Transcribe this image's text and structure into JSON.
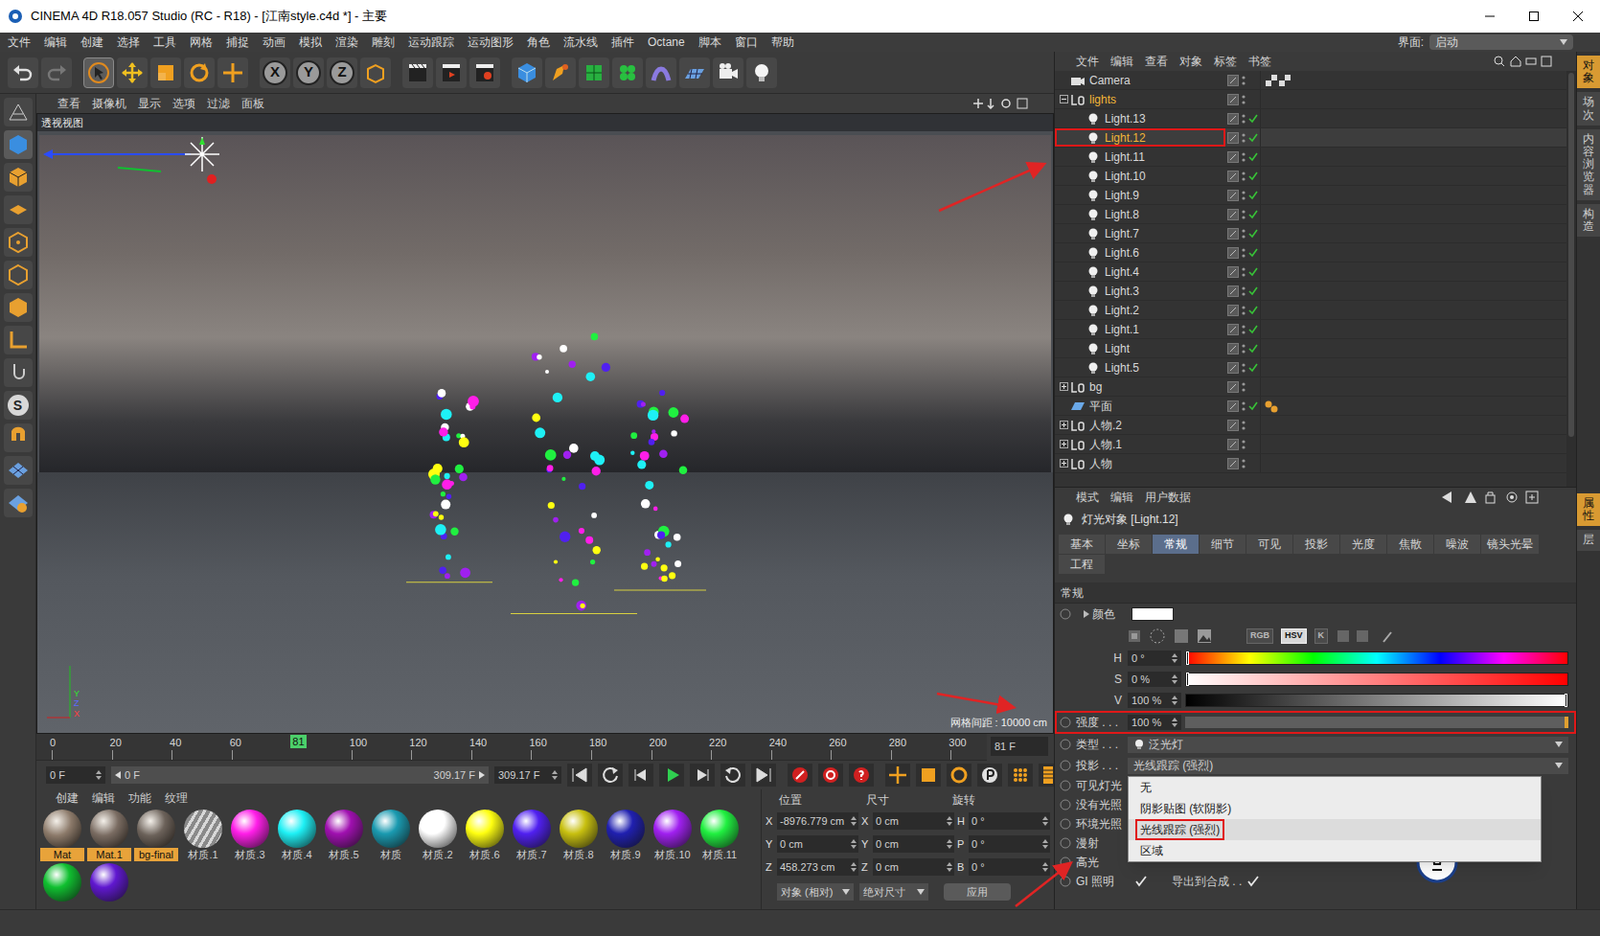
{
  "window": {
    "title": "CINEMA 4D R18.057 Studio (RC - R18) - [江南style.c4d *] - 主要"
  },
  "menu": [
    "文件",
    "编辑",
    "创建",
    "选择",
    "工具",
    "网格",
    "捕捉",
    "动画",
    "模拟",
    "渲染",
    "雕刻",
    "运动跟踪",
    "运动图形",
    "角色",
    "流水线",
    "插件",
    "Octane",
    "脚本",
    "窗口",
    "帮助"
  ],
  "layout_switch": {
    "label": "界面:",
    "value": "启动"
  },
  "toolbar": {
    "axes": [
      "X",
      "Y",
      "Z"
    ]
  },
  "left_tools": {
    "snap_label": "S"
  },
  "viewport": {
    "menu": [
      "查看",
      "摄像机",
      "显示",
      "选项",
      "过滤",
      "面板"
    ],
    "label": "透视视图",
    "grid": "网格间距 : 10000 cm",
    "axes": [
      "Y",
      "Z",
      "X"
    ]
  },
  "timeline": {
    "ticks": [
      "0",
      "20",
      "40",
      "60",
      "100",
      "120",
      "140",
      "160",
      "180",
      "200",
      "220",
      "240",
      "260",
      "280",
      "300"
    ],
    "length": 309.17,
    "current": "81",
    "level": 0.262,
    "frame_field": "81 F",
    "start_field": "0 F",
    "range_start": "0 F",
    "range_end": "309.17 F",
    "end_field": "309.17 F"
  },
  "materials": {
    "menu": [
      "创建",
      "编辑",
      "功能",
      "纹理"
    ],
    "items": [
      {
        "name": "Mat",
        "kind": "texture",
        "color": "#8c7a6a",
        "selected": true
      },
      {
        "name": "Mat.1",
        "kind": "texture",
        "color": "#7a6c62",
        "selected": true
      },
      {
        "name": "bg-final",
        "kind": "texture",
        "color": "#6c625a",
        "selected": true
      },
      {
        "name": "材质.1",
        "kind": "stripes",
        "color": "#8a8a8a",
        "selected": false
      },
      {
        "name": "材质.3",
        "kind": "color",
        "color": "#ff1ee8",
        "selected": false
      },
      {
        "name": "材质.4",
        "kind": "color",
        "color": "#1ef0f5",
        "selected": false
      },
      {
        "name": "材质.5",
        "kind": "color",
        "color": "#a010b0",
        "selected": false
      },
      {
        "name": "材质",
        "kind": "color",
        "color": "#1a9ab0",
        "selected": false
      },
      {
        "name": "材质.2",
        "kind": "color",
        "color": "#ffffff",
        "selected": false
      },
      {
        "name": "材质.6",
        "kind": "color",
        "color": "#ffff10",
        "selected": false
      },
      {
        "name": "材质.7",
        "kind": "color",
        "color": "#5020f0",
        "selected": false
      },
      {
        "name": "材质.8",
        "kind": "color",
        "color": "#c8c010",
        "selected": false
      },
      {
        "name": "材质.9",
        "kind": "color",
        "color": "#2020b0",
        "selected": false
      },
      {
        "name": "材质.10",
        "kind": "color",
        "color": "#a020f0",
        "selected": false
      },
      {
        "name": "材质.11",
        "kind": "color",
        "color": "#20f040",
        "selected": false
      },
      {
        "kind": "color",
        "color": "#10c030",
        "selected": false
      },
      {
        "kind": "color",
        "color": "#6018d0",
        "selected": false
      }
    ]
  },
  "coords": {
    "headers": [
      "位置",
      "尺寸",
      "旋转"
    ],
    "rows": [
      {
        "pos_axis": "X",
        "pos": "-8976.779 cm",
        "size_axis": "X",
        "size": "0 cm",
        "rot_axis": "H",
        "rot": "0 °"
      },
      {
        "pos_axis": "Y",
        "pos": "0 cm",
        "size_axis": "Y",
        "size": "0 cm",
        "rot_axis": "P",
        "rot": "0 °"
      },
      {
        "pos_axis": "Z",
        "pos": "458.273 cm",
        "size_axis": "Z",
        "size": "0 cm",
        "rot_axis": "B",
        "rot": "0 °"
      }
    ],
    "mode": "对象 (相对)",
    "size_mode": "绝对尺寸",
    "apply": "应用"
  },
  "objects": {
    "menu": [
      "文件",
      "编辑",
      "查看",
      "对象",
      "标签",
      "书签"
    ],
    "items": [
      {
        "name": "Camera",
        "kind": "camera",
        "depth": 0,
        "expandable": false,
        "expanded": false,
        "selected": false,
        "annotated": false,
        "enabled": false,
        "tag": "target"
      },
      {
        "name": "lights",
        "kind": "null",
        "depth": 0,
        "expandable": true,
        "expanded": true,
        "selected": true,
        "annotated": false,
        "enabled": false,
        "tag": "none"
      },
      {
        "name": "Light.13",
        "kind": "light",
        "depth": 1,
        "expandable": false,
        "expanded": false,
        "selected": false,
        "annotated": false,
        "enabled": true,
        "tag": "none"
      },
      {
        "name": "Light.12",
        "kind": "light",
        "depth": 1,
        "expandable": false,
        "expanded": false,
        "selected": true,
        "annotated": true,
        "enabled": true,
        "tag": "none"
      },
      {
        "name": "Light.11",
        "kind": "light",
        "depth": 1,
        "expandable": false,
        "expanded": false,
        "selected": false,
        "annotated": false,
        "enabled": true,
        "tag": "none"
      },
      {
        "name": "Light.10",
        "kind": "light",
        "depth": 1,
        "expandable": false,
        "expanded": false,
        "selected": false,
        "annotated": false,
        "enabled": true,
        "tag": "none"
      },
      {
        "name": "Light.9",
        "kind": "light",
        "depth": 1,
        "expandable": false,
        "expanded": false,
        "selected": false,
        "annotated": false,
        "enabled": true,
        "tag": "none"
      },
      {
        "name": "Light.8",
        "kind": "light",
        "depth": 1,
        "expandable": false,
        "expanded": false,
        "selected": false,
        "annotated": false,
        "enabled": true,
        "tag": "none"
      },
      {
        "name": "Light.7",
        "kind": "light",
        "depth": 1,
        "expandable": false,
        "expanded": false,
        "selected": false,
        "annotated": false,
        "enabled": true,
        "tag": "none"
      },
      {
        "name": "Light.6",
        "kind": "light",
        "depth": 1,
        "expandable": false,
        "expanded": false,
        "selected": false,
        "annotated": false,
        "enabled": true,
        "tag": "none"
      },
      {
        "name": "Light.4",
        "kind": "light",
        "depth": 1,
        "expandable": false,
        "expanded": false,
        "selected": false,
        "annotated": false,
        "enabled": true,
        "tag": "none"
      },
      {
        "name": "Light.3",
        "kind": "light",
        "depth": 1,
        "expandable": false,
        "expanded": false,
        "selected": false,
        "annotated": false,
        "enabled": true,
        "tag": "none"
      },
      {
        "name": "Light.2",
        "kind": "light",
        "depth": 1,
        "expandable": false,
        "expanded": false,
        "selected": false,
        "annotated": false,
        "enabled": true,
        "tag": "none"
      },
      {
        "name": "Light.1",
        "kind": "light",
        "depth": 1,
        "expandable": false,
        "expanded": false,
        "selected": false,
        "annotated": false,
        "enabled": true,
        "tag": "none"
      },
      {
        "name": "Light",
        "kind": "light",
        "depth": 1,
        "expandable": false,
        "expanded": false,
        "selected": false,
        "annotated": false,
        "enabled": true,
        "tag": "none"
      },
      {
        "name": "Light.5",
        "kind": "light",
        "depth": 1,
        "expandable": false,
        "expanded": false,
        "selected": false,
        "annotated": false,
        "enabled": true,
        "tag": "none"
      },
      {
        "name": "bg",
        "kind": "null",
        "depth": 0,
        "expandable": true,
        "expanded": false,
        "selected": false,
        "annotated": false,
        "enabled": false,
        "tag": "none"
      },
      {
        "name": "平面",
        "kind": "plane",
        "depth": 0,
        "expandable": false,
        "expanded": false,
        "selected": false,
        "annotated": false,
        "enabled": true,
        "tag": "material"
      },
      {
        "name": "人物.2",
        "kind": "null",
        "depth": 0,
        "expandable": true,
        "expanded": false,
        "selected": false,
        "annotated": false,
        "enabled": false,
        "tag": "none"
      },
      {
        "name": "人物.1",
        "kind": "null",
        "depth": 0,
        "expandable": true,
        "expanded": false,
        "selected": false,
        "annotated": false,
        "enabled": false,
        "tag": "none"
      },
      {
        "name": "人物",
        "kind": "null",
        "depth": 0,
        "expandable": true,
        "expanded": false,
        "selected": false,
        "annotated": false,
        "enabled": false,
        "tag": "none"
      }
    ]
  },
  "attributes": {
    "menu": [
      "模式",
      "编辑",
      "用户数据"
    ],
    "title": "灯光对象 [Light.12]",
    "tabs": [
      {
        "label": "基本",
        "selected": false
      },
      {
        "label": "坐标",
        "selected": false
      },
      {
        "label": "常规",
        "selected": true
      },
      {
        "label": "细节",
        "selected": false
      },
      {
        "label": "可见",
        "selected": false
      },
      {
        "label": "投影",
        "selected": false
      },
      {
        "label": "光度",
        "selected": false
      },
      {
        "label": "焦散",
        "selected": false
      },
      {
        "label": "噪波",
        "selected": false
      },
      {
        "label": "镜头光晕",
        "selected": false
      },
      {
        "label": "工程",
        "selected": false
      }
    ],
    "section": "常规",
    "color": {
      "label": "颜色",
      "value": "#ffffff"
    },
    "color_modes": [
      {
        "label": "RGB",
        "selected": false
      },
      {
        "label": "HSV",
        "selected": true
      },
      {
        "label": "K",
        "selected": false
      }
    ],
    "hsv": [
      {
        "label": "H",
        "value": "0 °",
        "level": 0,
        "kind": "hue"
      },
      {
        "label": "S",
        "value": "0 %",
        "level": 0,
        "kind": "saturation"
      },
      {
        "label": "V",
        "value": "100 %",
        "level": 1,
        "kind": "value"
      }
    ],
    "intensity": {
      "label": "强度 . . .",
      "value": "100 %",
      "level": 1,
      "annotated": true
    },
    "type": {
      "label": "类型 . . .",
      "value": "泛光灯"
    },
    "shadow": {
      "label": "投影 . . .",
      "value": "光线跟踪 (强烈)",
      "open": true,
      "options": [
        {
          "label": "无",
          "selected": false,
          "annotated": false
        },
        {
          "label": "阴影贴图 (软阴影)",
          "selected": false,
          "annotated": false
        },
        {
          "label": "光线跟踪 (强烈)",
          "selected": true,
          "annotated": true
        },
        {
          "label": "区域",
          "selected": false,
          "annotated": false
        }
      ]
    },
    "rows": [
      {
        "label": "可见灯光"
      },
      {
        "label": "没有光照"
      },
      {
        "label": "环境光照"
      },
      {
        "label": "漫射"
      },
      {
        "label": "高光"
      },
      {
        "label": "GI 照明",
        "checked": true,
        "extra_label": "导出到合成 . .",
        "extra_checked": true
      }
    ]
  },
  "side_tabs": {
    "top": [
      {
        "label": "对象",
        "selected": true
      },
      {
        "label": "场次",
        "selected": false
      },
      {
        "label": "内容浏览器",
        "selected": false
      },
      {
        "label": "构造",
        "selected": false
      }
    ],
    "bottom": [
      {
        "label": "属性",
        "selected": true
      },
      {
        "label": "层",
        "selected": false
      }
    ]
  }
}
